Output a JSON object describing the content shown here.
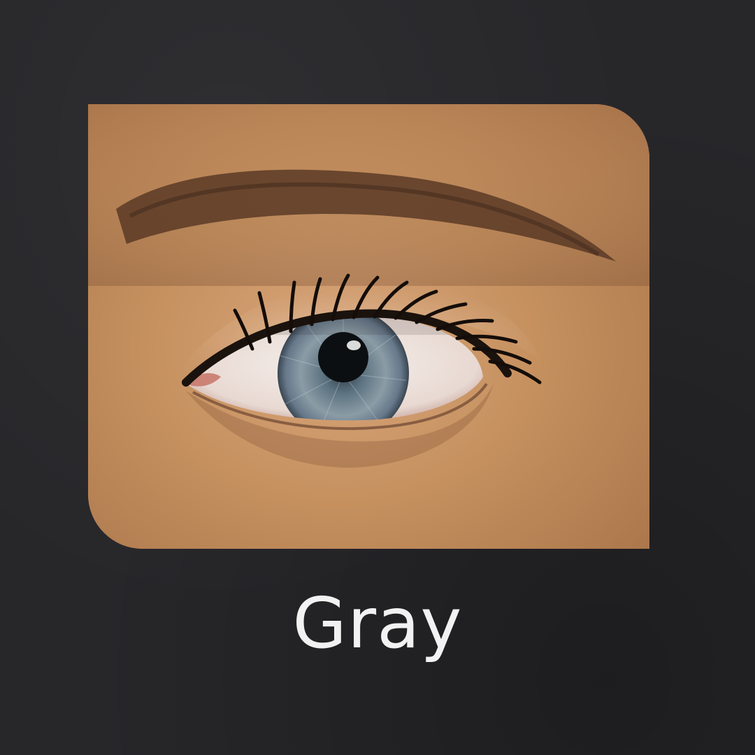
{
  "product": {
    "color_name": "Gray"
  },
  "photo": {
    "subject": "eye-closeup",
    "iris_color": "#7b8c96",
    "skin_color": "#c8946a"
  },
  "theme": {
    "background": "#27272a",
    "caption_color": "#f2f2f2"
  }
}
